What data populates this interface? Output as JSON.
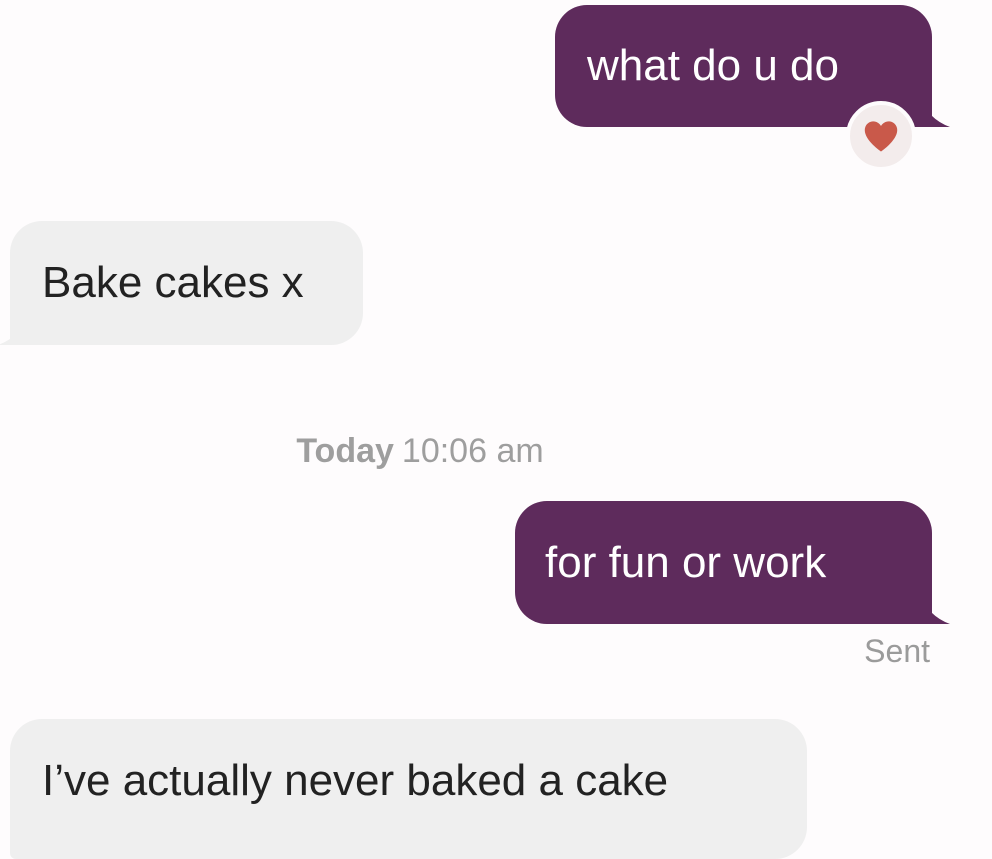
{
  "messages": [
    {
      "id": "msg1",
      "direction": "outgoing",
      "text": "what do u do",
      "reaction": "heart"
    },
    {
      "id": "msg2",
      "direction": "incoming",
      "text": "Bake cakes x"
    },
    {
      "id": "msg3",
      "direction": "outgoing",
      "text": "for fun or work"
    },
    {
      "id": "msg4",
      "direction": "incoming",
      "text": "I’ve actually never baked a cake"
    }
  ],
  "timestamp": {
    "day": "Today",
    "time": "10:06 am"
  },
  "status": "Sent",
  "colors": {
    "outgoing_bubble": "#5e2b5c",
    "incoming_bubble": "#efefef",
    "heart": "#c9594a",
    "reaction_bg": "#f3ecec",
    "timestamp_text": "#9e9e9e"
  },
  "icons": {
    "reaction": "heart-icon"
  }
}
